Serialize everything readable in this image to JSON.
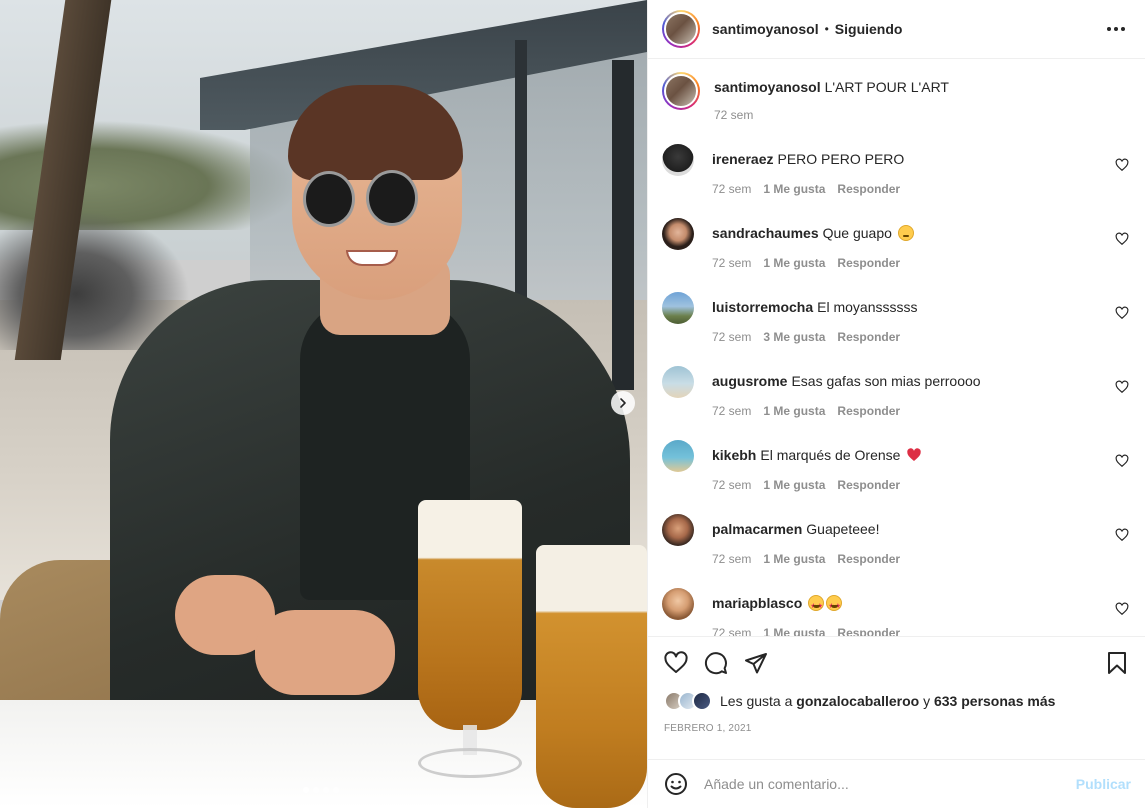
{
  "post": {
    "author": "santimoyanosol",
    "separator": "•",
    "follow_status": "Siguiendo",
    "caption": "L'ART POUR L'ART",
    "caption_time": "72 sem"
  },
  "media": {
    "slide_count": 4,
    "active_slide": 1
  },
  "labels": {
    "likes_suffix": "Me gusta",
    "reply": "Responder"
  },
  "comments": [
    {
      "user": "ireneraez",
      "text": "PERO PERO PERO",
      "time": "72 sem",
      "likes": "1",
      "emoji": ""
    },
    {
      "user": "sandrachaumes",
      "text": "Que guapo",
      "time": "72 sem",
      "likes": "1",
      "emoji": "flushed-face"
    },
    {
      "user": "luistorremocha",
      "text": "El moyanssssss",
      "time": "72 sem",
      "likes": "3",
      "emoji": ""
    },
    {
      "user": "augusrome",
      "text": "Esas gafas son mias perroooo",
      "time": "72 sem",
      "likes": "1",
      "emoji": ""
    },
    {
      "user": "kikebh",
      "text": "El marqués de Orense",
      "time": "72 sem",
      "likes": "1",
      "emoji": "red-heart"
    },
    {
      "user": "palmacarmen",
      "text": "Guapeteee!",
      "time": "72 sem",
      "likes": "1",
      "emoji": ""
    },
    {
      "user": "mariapblasco",
      "text": "",
      "time": "72 sem",
      "likes": "1",
      "emoji": "star-struck x2"
    }
  ],
  "likes": {
    "prefix": "Les gusta a",
    "user": "gonzalocaballeroo",
    "joiner": "y",
    "others": "633 personas más"
  },
  "date": "FEBRERO 1, 2021",
  "add_comment": {
    "placeholder": "Añade un comentario...",
    "publish": "Publicar"
  },
  "colors": {
    "text": "#262626",
    "muted": "#8e8e8e",
    "publish_disabled": "#b2dffc",
    "heart": "#e0245e",
    "border": "#efefef"
  },
  "icons": [
    "next-arrow-icon",
    "more-options-icon",
    "heart-outline-icon",
    "comment-icon",
    "share-icon",
    "bookmark-icon",
    "emoji-icon"
  ]
}
